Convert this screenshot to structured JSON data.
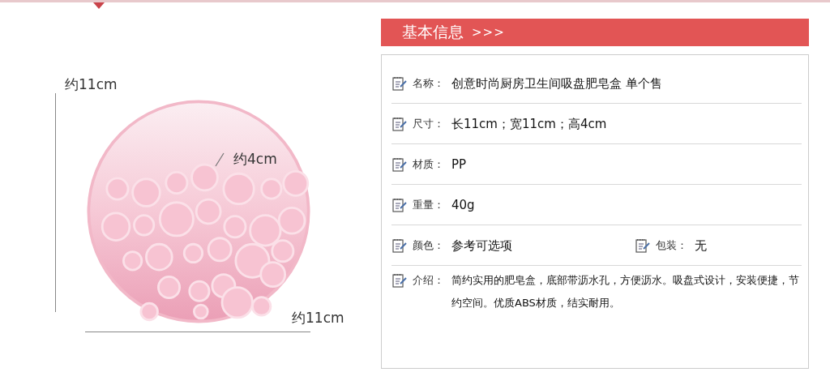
{
  "product_image": {
    "height_label": "约11cm",
    "depth_label": "约4cm",
    "width_label": "约11cm"
  },
  "info": {
    "title": "基本信息",
    "arrows": ">>>",
    "rows": [
      {
        "fields": [
          {
            "label": "名称：",
            "value": "创意时尚厨房卫生间吸盘肥皂盒 单个售"
          }
        ]
      },
      {
        "fields": [
          {
            "label": "尺寸：",
            "value": "长11cm；宽11cm；高4cm"
          }
        ]
      },
      {
        "fields": [
          {
            "label": "材质：",
            "value": "PP"
          }
        ]
      },
      {
        "fields": [
          {
            "label": "重量：",
            "value": "40g"
          }
        ]
      },
      {
        "fields": [
          {
            "label": "颜色：",
            "value": "参考可选项"
          },
          {
            "label": "包装：",
            "value": "无"
          }
        ]
      },
      {
        "fields": [
          {
            "label": "介绍：",
            "value": "简约实用的肥皂盒，底部带沥水孔，方便沥水。吸盘式设计，安装便捷，节约空间。优质ABS材质，结实耐用。"
          }
        ]
      }
    ]
  }
}
